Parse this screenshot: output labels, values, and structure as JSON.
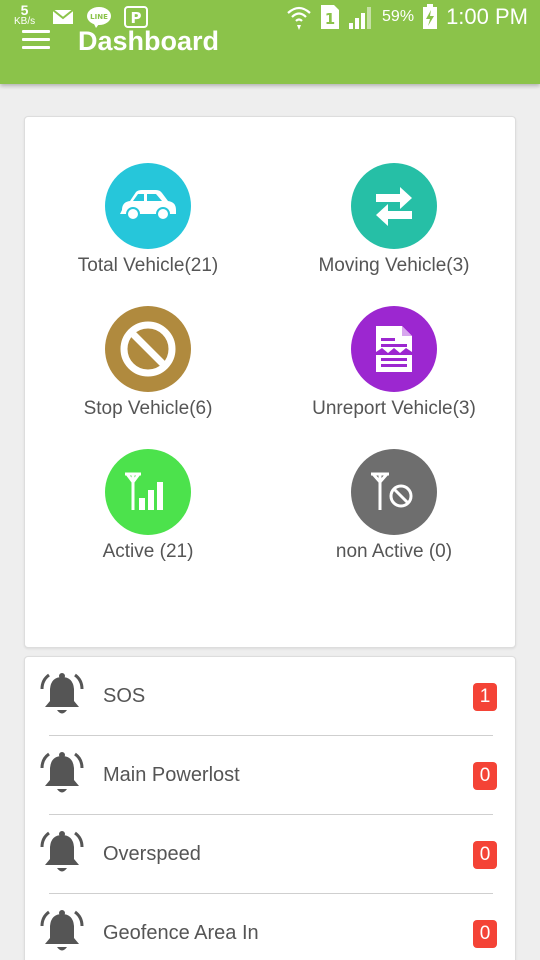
{
  "status_bar": {
    "speed_value": "5",
    "speed_unit": "KB/s",
    "battery_percent": "59%",
    "time": "1:00 PM",
    "sim_label": "1",
    "icons": [
      "mail-icon",
      "line-app-icon",
      "p-app-icon",
      "wifi-icon",
      "sim-icon",
      "signal-icon",
      "battery-icon"
    ]
  },
  "app_bar": {
    "title": "Dashboard",
    "color": "#8bc34a"
  },
  "tiles": [
    {
      "label": "Total Vehicle(21)",
      "icon": "car-icon",
      "color": "#26c6da"
    },
    {
      "label": "Moving Vehicle(3)",
      "icon": "swap-arrows-icon",
      "color": "#26bfa6"
    },
    {
      "label": "Stop Vehicle(6)",
      "icon": "block-icon",
      "color": "#b08a3e"
    },
    {
      "label": "Unreport Vehicle(3)",
      "icon": "report-icon",
      "color": "#9c27d0"
    },
    {
      "label": "Active (21)",
      "icon": "signal-bars-icon",
      "color": "#4ce24c"
    },
    {
      "label": "non Active (0)",
      "icon": "no-signal-icon",
      "color": "#6e6e6e"
    }
  ],
  "alerts": [
    {
      "label": "SOS",
      "count": "1"
    },
    {
      "label": "Main Powerlost",
      "count": "0"
    },
    {
      "label": "Overspeed",
      "count": "0"
    },
    {
      "label": "Geofence Area In",
      "count": "0"
    }
  ],
  "colors": {
    "badge": "#f44336",
    "bell": "#555555",
    "text": "#555555"
  }
}
